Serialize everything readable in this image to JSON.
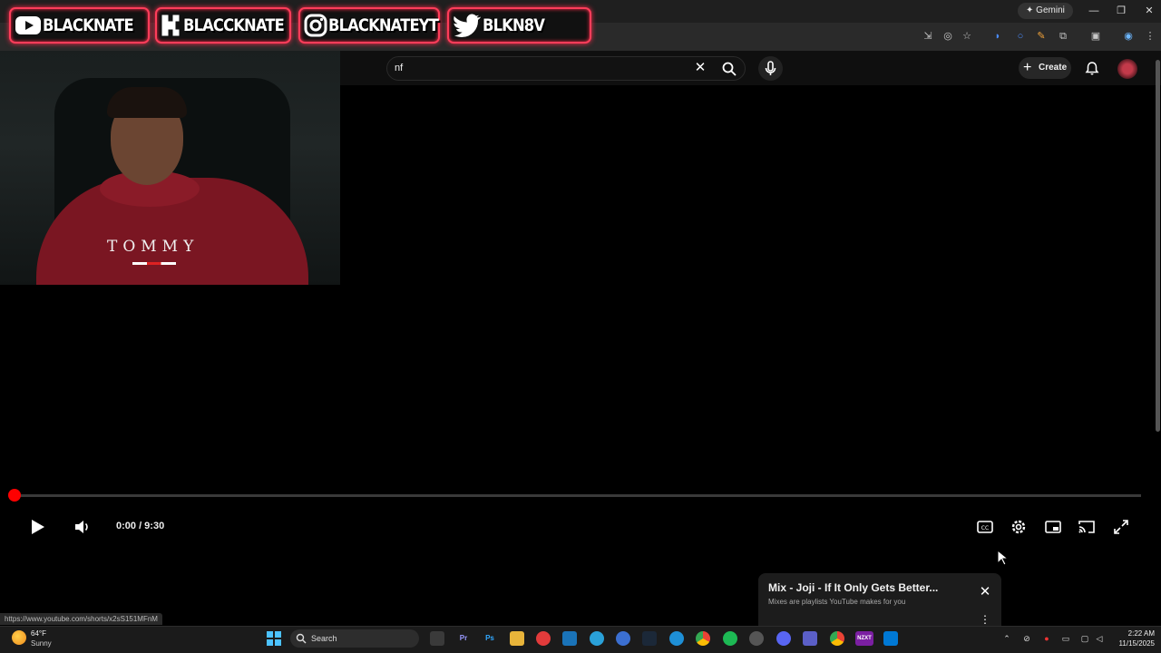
{
  "browser": {
    "gemini_label": "Gemini",
    "status_url": "https://www.youtube.com/shorts/x2sS151MFnM"
  },
  "overlay": {
    "badges": [
      {
        "platform": "youtube",
        "handle": "BLACKNATE"
      },
      {
        "platform": "kick",
        "handle": "BLACCKNATE"
      },
      {
        "platform": "instagram",
        "handle": "BLACKNATEYT"
      },
      {
        "platform": "twitter",
        "handle": "BLKN8V"
      }
    ],
    "webcam_shirt_text": "TOMMY"
  },
  "youtube": {
    "search": {
      "value": "nf"
    },
    "create_label": "Create",
    "player": {
      "time_display": "0:00 / 9:30",
      "progress": 0,
      "controls": [
        "play-icon",
        "volume-icon",
        "captions-icon",
        "settings-icon",
        "miniplayer-icon",
        "cast-icon",
        "fullscreen-icon"
      ]
    },
    "mix_card": {
      "title": "Mix - Joji - If It Only Gets Better...",
      "subtitle": "Mixes are playlists YouTube makes for you"
    }
  },
  "taskbar": {
    "weather": {
      "temp": "64°F",
      "condition": "Sunny"
    },
    "search_label": "Search",
    "clock": {
      "time": "2:22 AM",
      "date": "11/15/2025"
    },
    "apps": [
      {
        "name": "premiere",
        "label": "Pr",
        "color": "#2a0a5e",
        "fg": "#9999ff"
      },
      {
        "name": "photoshop",
        "label": "Ps",
        "color": "#001e36",
        "fg": "#31a8ff"
      },
      {
        "name": "nzxt",
        "label": "NZXT",
        "color": "#7b1fa2",
        "fg": "#ffffff"
      }
    ]
  },
  "colors": {
    "accent_red": "#ff0000",
    "banner_glow": "#ff3d5a",
    "windows_blue": "#4cc2ff"
  }
}
